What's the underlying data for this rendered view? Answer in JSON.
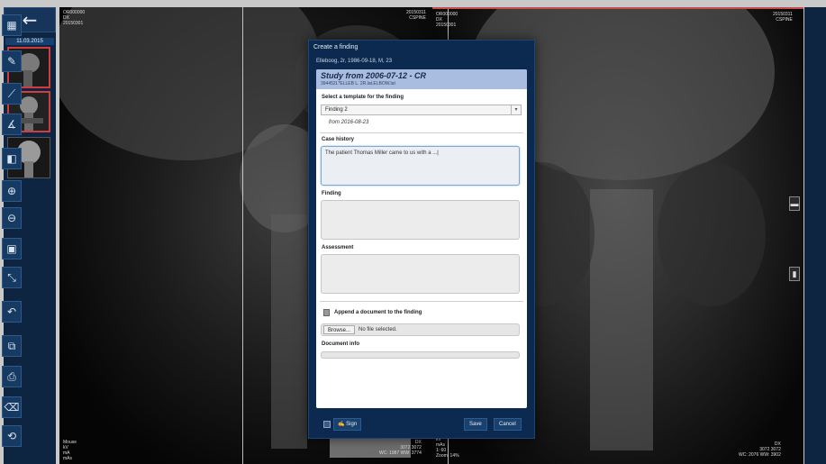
{
  "rail": {
    "back_icon": "arrow-left-icon",
    "date": "11.03.2015"
  },
  "left_viewport": {
    "top_left": "OR000000\nDX\n20150301",
    "top_right": "20150311\nCSPINE",
    "bottom_left": "Mouse\nkV\nmA\nmAs",
    "bottom_right": "DX\n3072 3072\nWC: 1987 WW: 3774"
  },
  "right_viewport": {
    "top_left": "OR000000\nDX\n20150301",
    "top_right": "20150311\nCSPINE",
    "bottom_left": "kV\nmAs\n1: 60\nZoom: 14%",
    "bottom_right": "DX\n3072 3072\nWC: 2076 WW: 3902"
  },
  "dialog": {
    "title": "Create a finding",
    "patient": "Elleboog, 2r, 1986-09-18, M, 23",
    "study_title": "Study from 2006-07-12 - CR",
    "study_detail": "394452L*ELLEB L. 2R.lat.ELBOW.lat",
    "template_label": "Select a template for the finding",
    "template_value": "Finding 2",
    "template_from": "from 2016-08-23",
    "case_history_label": "Case history",
    "case_history_value": "The patient Thomas Miller came to us with a ...|",
    "finding_label": "Finding",
    "finding_value": "",
    "assessment_label": "Assessment",
    "assessment_value": "",
    "append_label": "Append a document to the finding",
    "browse_label": "Browse...",
    "file_status": "No file selected.",
    "doc_info_label": "Document info",
    "sign_label": "Sign",
    "save_label": "Save",
    "cancel_label": "Cancel"
  },
  "colors": {
    "dialog_bg": "#0c2a4f",
    "study_header": "#a8bde0",
    "selected_border": "#d23c3c"
  }
}
